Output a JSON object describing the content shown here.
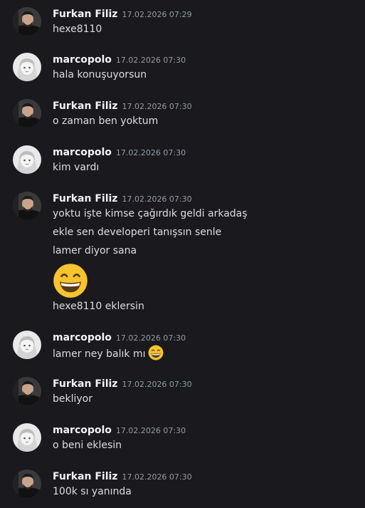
{
  "messages": [
    {
      "author": "Furkan Filiz",
      "avatar": "furkan-avatar",
      "timestamp": "17.02.2026 07:29",
      "lines": [
        "hexe8110"
      ]
    },
    {
      "author": "marcopolo",
      "avatar": "marcopolo-avatar",
      "timestamp": "17.02.2026 07:30",
      "lines": [
        "hala konuşuyorsun"
      ]
    },
    {
      "author": "Furkan Filiz",
      "avatar": "furkan-avatar",
      "timestamp": "17.02.2026 07:30",
      "lines": [
        "o zaman ben yoktum"
      ]
    },
    {
      "author": "marcopolo",
      "avatar": "marcopolo-avatar",
      "timestamp": "17.02.2026 07:30",
      "lines": [
        "kim vardı"
      ]
    },
    {
      "author": "Furkan Filiz",
      "avatar": "furkan-avatar",
      "timestamp": "17.02.2026 07:30",
      "lines": [
        "yoktu işte kimse çağırdık geldi arkadaş",
        "ekle sen developeri tanışsın senle",
        "lamer diyor sana",
        "hexe8110 eklersin"
      ],
      "emoji": "grinning-face-emoji"
    },
    {
      "author": "marcopolo",
      "avatar": "marcopolo-avatar",
      "timestamp": "17.02.2026 07:30",
      "lines": [
        "lamer ney balık mı"
      ],
      "emoji": "grinning-face-emoji"
    },
    {
      "author": "Furkan Filiz",
      "avatar": "furkan-avatar",
      "timestamp": "17.02.2026 07:30",
      "lines": [
        "bekliyor"
      ]
    },
    {
      "author": "marcopolo",
      "avatar": "marcopolo-avatar",
      "timestamp": "17.02.2026 07:30",
      "lines": [
        "o beni eklesin"
      ]
    },
    {
      "author": "Furkan Filiz",
      "avatar": "furkan-avatar",
      "timestamp": "17.02.2026 07:30",
      "lines": [
        "100k sı yanında"
      ]
    }
  ],
  "colors": {
    "background": "#1a1a1e",
    "username": "#f2f3f5",
    "text": "#dbdee1",
    "timestamp": "#949ba4",
    "emoji": "#f7c32e"
  }
}
